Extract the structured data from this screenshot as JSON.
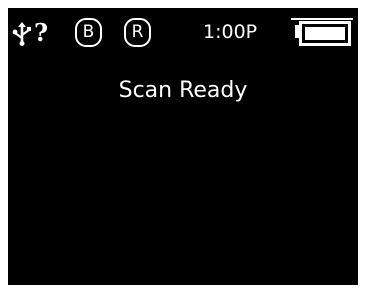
{
  "status_bar": {
    "connection_icon": "usb-icon",
    "connection_status": "?",
    "badge_b": "B",
    "badge_r": "R",
    "time": "1:00P",
    "battery_icon": "battery-full-icon",
    "battery_level": 1.0
  },
  "main": {
    "message": "Scan Ready"
  },
  "colors": {
    "background": "#000000",
    "foreground": "#ffffff",
    "bezel": "#ffffff"
  }
}
